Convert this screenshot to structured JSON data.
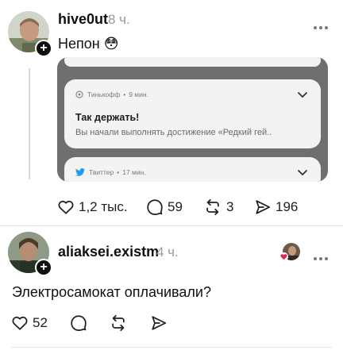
{
  "post1": {
    "username": "hive0ut",
    "time": "8 ч.",
    "text": "Непон 😳",
    "embed": {
      "notif_main_app": "Тинькофф",
      "notif_main_time": "9 мин.",
      "notif_main_title": "Так держать!",
      "notif_main_body": "Вы начали выполнять достижение «Редкий гей..",
      "notif_bottom_app": "Твиттер",
      "notif_bottom_time": "17 мин."
    },
    "actions": {
      "likes": "1,2 тыс.",
      "replies": "59",
      "reposts": "3",
      "shares": "196"
    }
  },
  "post2": {
    "username": "aliaksei.existm",
    "time": "4 ч.",
    "text": "Электросамокат оплачивали?",
    "actions": {
      "likes": "52"
    }
  },
  "icons": {
    "like": "heart-icon",
    "reply": "comment-bubble-icon",
    "repost": "repost-arrows-icon",
    "share": "paper-plane-icon",
    "more": "more-dots-icon",
    "follow": "plus-icon"
  },
  "colors": {
    "text": "#101010",
    "muted": "#999999",
    "embed_frame": "#6f6f6f",
    "notification_card": "#f3f3f3",
    "twitter_blue": "#1d9bf0",
    "reaction_heart": "#e0245e"
  }
}
